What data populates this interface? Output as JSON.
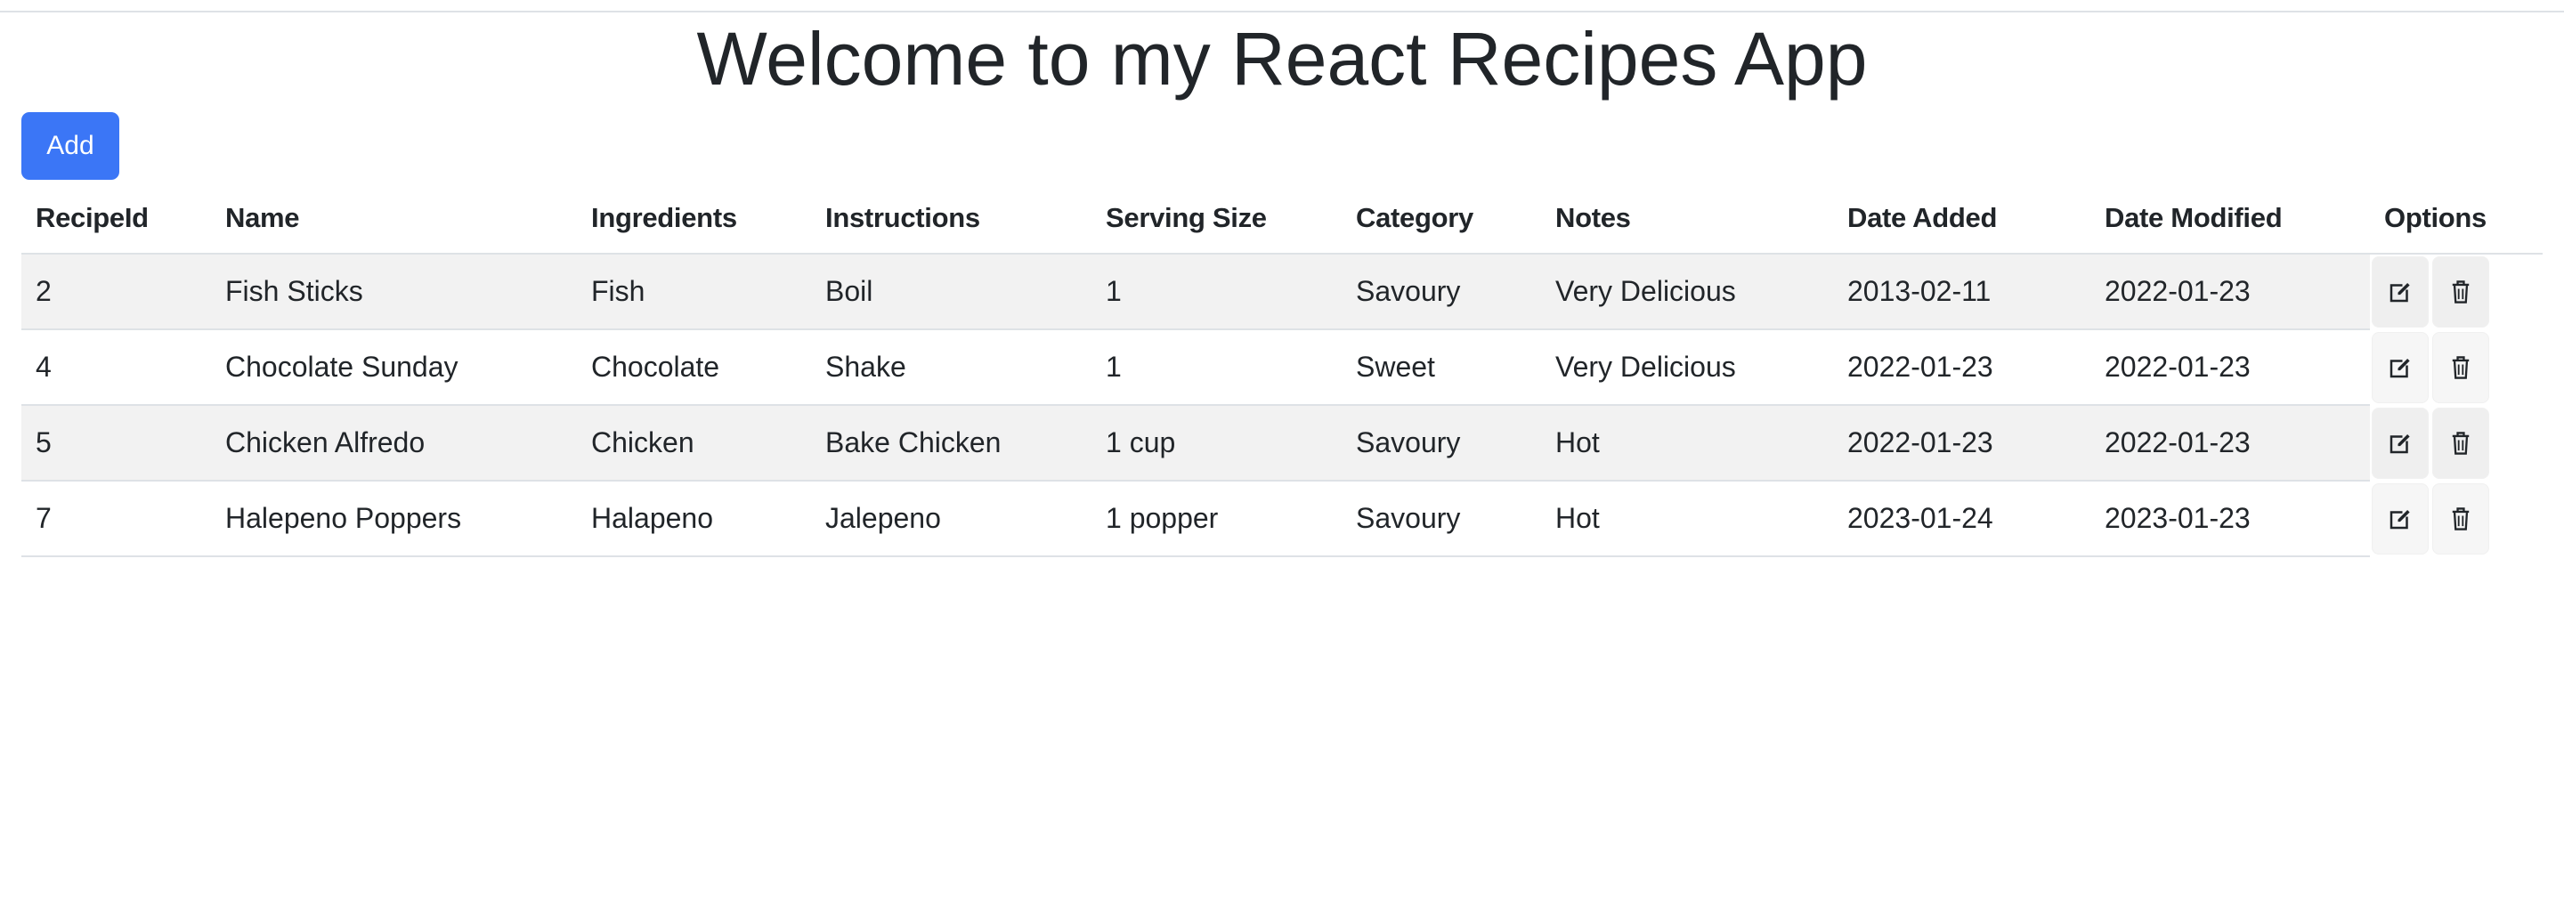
{
  "page": {
    "title": "Welcome to my React Recipes App"
  },
  "toolbar": {
    "add_label": "Add"
  },
  "table": {
    "headers": {
      "recipe_id": "RecipeId",
      "name": "Name",
      "ingredients": "Ingredients",
      "instructions": "Instructions",
      "serving_size": "Serving Size",
      "category": "Category",
      "notes": "Notes",
      "date_added": "Date Added",
      "date_modified": "Date Modified",
      "options": "Options"
    },
    "rows": [
      {
        "recipe_id": "2",
        "name": "Fish Sticks",
        "ingredients": "Fish",
        "instructions": "Boil",
        "serving_size": "1",
        "category": "Savoury",
        "notes": "Very Delicious",
        "date_added": "2013-02-11",
        "date_modified": "2022-01-23"
      },
      {
        "recipe_id": "4",
        "name": "Chocolate Sunday",
        "ingredients": "Chocolate",
        "instructions": "Shake",
        "serving_size": "1",
        "category": "Sweet",
        "notes": "Very Delicious",
        "date_added": "2022-01-23",
        "date_modified": "2022-01-23"
      },
      {
        "recipe_id": "5",
        "name": "Chicken Alfredo",
        "ingredients": "Chicken",
        "instructions": "Bake Chicken",
        "serving_size": "1 cup",
        "category": "Savoury",
        "notes": "Hot",
        "date_added": "2022-01-23",
        "date_modified": "2022-01-23"
      },
      {
        "recipe_id": "7",
        "name": "Halepeno Poppers",
        "ingredients": "Halapeno",
        "instructions": "Jalepeno",
        "serving_size": "1 popper",
        "category": "Savoury",
        "notes": "Hot",
        "date_added": "2023-01-24",
        "date_modified": "2023-01-23"
      }
    ]
  },
  "icons": {
    "edit": "edit-icon",
    "delete": "trash-icon"
  },
  "colors": {
    "primary_button": "#3b76f6",
    "stripe": "#f2f2f2",
    "border": "#dee2e6",
    "text": "#212529"
  }
}
